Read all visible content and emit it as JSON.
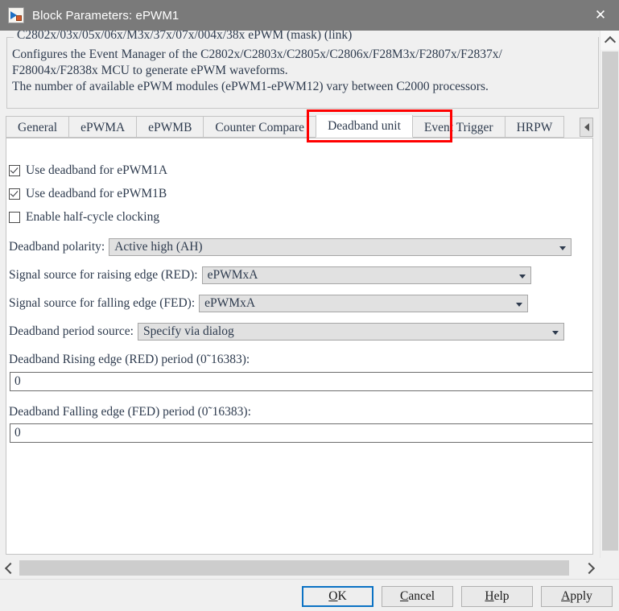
{
  "window": {
    "title": "Block Parameters: ePWM1",
    "icon": "simulink-block-icon",
    "close_label": "✕"
  },
  "description": {
    "group_title": "C2802x/03x/05x/06x/M3x/37x/07x/004x/38x ePWM (mask) (link)",
    "lines": [
      "Configures the Event Manager of the C2802x/C2803x/C2805x/C2806x/F28M3x/F2807x/F2837x/",
      "F28004x/F2838x MCU to generate ePWM waveforms.",
      "The number of available ePWM modules (ePWM1-ePWM12) vary between C2000 processors."
    ]
  },
  "tabs": {
    "items": [
      {
        "label": "General",
        "active": false
      },
      {
        "label": "ePWMA",
        "active": false
      },
      {
        "label": "ePWMB",
        "active": false
      },
      {
        "label": "Counter Compare",
        "active": false
      },
      {
        "label": "Deadband unit",
        "active": true
      },
      {
        "label": "Event Trigger",
        "active": false
      },
      {
        "label": "HRPW",
        "active": false
      }
    ],
    "scroll_left_icon": "chevron-left-icon",
    "highlight_color": "#ff0000"
  },
  "form": {
    "checkboxes": [
      {
        "label": "Use deadband for ePWM1A",
        "checked": true
      },
      {
        "label": "Use deadband for ePWM1B",
        "checked": true
      },
      {
        "label": "Enable half-cycle clocking",
        "checked": false
      }
    ],
    "dropdowns": [
      {
        "label": "Deadband polarity:",
        "value": "Active high (AH)"
      },
      {
        "label": "Signal source for raising edge (RED):",
        "value": "ePWMxA"
      },
      {
        "label": "Signal source for falling edge (FED):",
        "value": "ePWMxA"
      },
      {
        "label": "Deadband period source:",
        "value": "Specify via dialog"
      }
    ],
    "text_fields": [
      {
        "label": "Deadband Rising edge (RED) period (0˜16383):",
        "value": "0"
      },
      {
        "label": "Deadband Falling edge (FED) period (0˜16383):",
        "value": "0"
      }
    ]
  },
  "scrollbars": {
    "vertical_up_icon": "chevron-up-icon",
    "horizontal_left_icon": "chevron-left-icon",
    "horizontal_right_icon": "chevron-right-icon"
  },
  "buttons": [
    {
      "prefix": "",
      "accel": "O",
      "suffix": "K",
      "name": "ok",
      "focused": true
    },
    {
      "prefix": "",
      "accel": "C",
      "suffix": "ancel",
      "name": "cancel",
      "focused": false
    },
    {
      "prefix": "",
      "accel": "H",
      "suffix": "elp",
      "name": "help",
      "focused": false
    },
    {
      "prefix": "",
      "accel": "A",
      "suffix": "pply",
      "name": "apply",
      "focused": false
    }
  ]
}
